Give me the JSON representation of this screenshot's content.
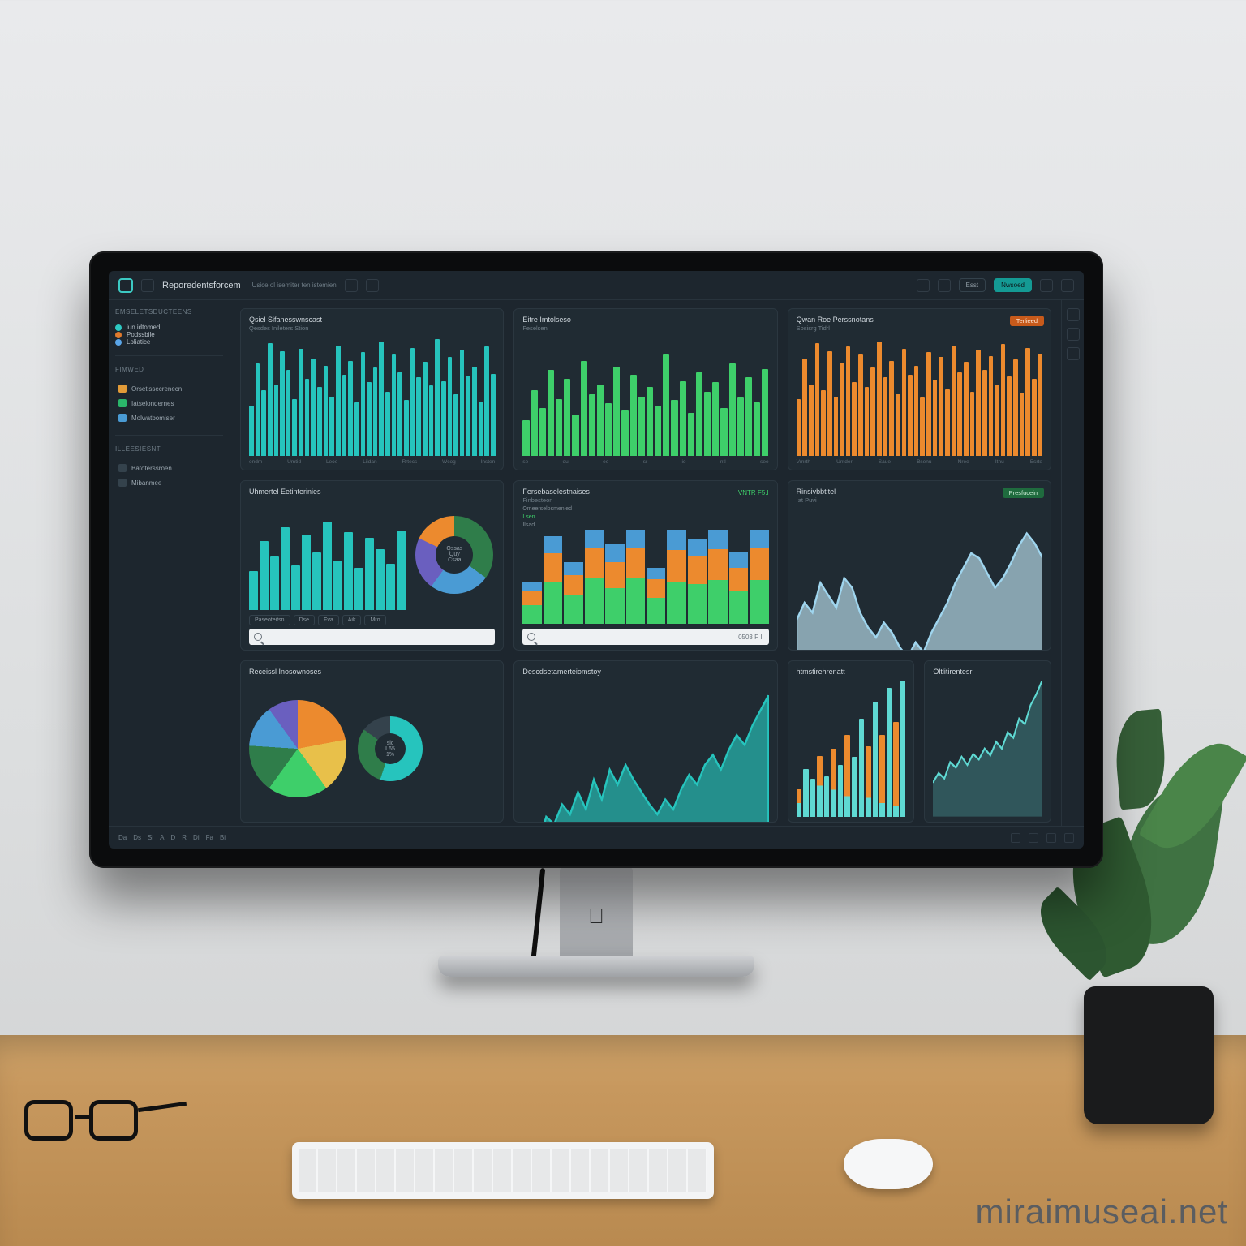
{
  "watermark": "miraimuseai.net",
  "header": {
    "title": "Reporedentsforcem",
    "subtitle": "Usice ol isemiter ten istemien",
    "action_primary": "Nwsoed",
    "action_secondary": "Esst"
  },
  "sidebar": {
    "section1_title": "Emseletsducteens",
    "legend": [
      {
        "label": "iun idtomed",
        "color": "#2dc9c3"
      },
      {
        "label": "Podssbile",
        "color": "#e07a2d"
      },
      {
        "label": "Loliatice",
        "color": "#5aa5e8"
      }
    ],
    "section2_title": "Fimwed",
    "items": [
      {
        "label": "Orsetissecrenecn",
        "color": "#e29b38"
      },
      {
        "label": "Iatselondernes",
        "color": "#2ab56a"
      },
      {
        "label": "Molwatbomiser",
        "color": "#4a9bd4"
      }
    ],
    "section3_title": "Illeesiesnt",
    "nav": [
      {
        "label": "Batoterssroen"
      },
      {
        "label": "Mibanmee"
      }
    ]
  },
  "cards": {
    "r1c1": {
      "title": "Qsiel Sifanesswnscast",
      "subtitle": "Qesdes Inileters Stion"
    },
    "r1c2": {
      "title": "Eitre Imtolseso",
      "subtitle": "Feselsen"
    },
    "r1c3": {
      "title": "Qwan Roe Perssnotans",
      "subtitle": "Sosisrg Tidrl",
      "badge": "Terlieed"
    },
    "r2c1": {
      "title": "Uhmertel Eetinterinies",
      "donut_center_top": "Qssas",
      "donut_center_mid": "Quy",
      "donut_center_bot": "Csaa",
      "search_placeholder": "",
      "toolbar": [
        "Paseoteitsn",
        "Dse",
        "Fva",
        "Aik",
        "Mro"
      ]
    },
    "r2c2": {
      "title": "Fersebaselestnaises",
      "subtitle": "Finbesteon",
      "stat": "VNTR F5.I",
      "search_value": "",
      "search_right": "0503 F II"
    },
    "r2c3": {
      "title": "Rinsivbbtitel",
      "subtitle": "Iat Puvi",
      "badge": "Presfucein"
    },
    "r3c1": {
      "title": "Receissl Inosownoses",
      "subtitle": "",
      "donut2_top": "sic",
      "donut2_mid": "L65",
      "donut2_bot": "1%"
    },
    "r3c2": {
      "title": "Descdsetamerteiomstoy"
    },
    "r3c3a": {
      "title": "htmstirehrenatt"
    },
    "r3c3b": {
      "title": "Oltlitirentesr"
    }
  },
  "footer": {
    "items": [
      "Da",
      "Ds",
      "Si",
      "A",
      "D",
      "R",
      "Di",
      "Fa",
      "Bi"
    ]
  },
  "colors": {
    "teal": "#26c4bd",
    "cyan": "#5fd9d3",
    "green": "#3ecf6a",
    "orange": "#ec8a2e",
    "orange2": "#d96b18",
    "blue": "#4a9bd4",
    "lightblue": "#9fd5ee",
    "purple": "#6a5fbf",
    "yellow": "#e8c04a",
    "darkgreen": "#2f7d4a"
  },
  "chart_data": [
    {
      "id": "r1c1",
      "type": "bar",
      "title": "Qsiel Sifanesswnscast",
      "categories": [
        "ondm",
        "Umtid",
        "Leoe",
        "Liidan",
        "Rrtecs",
        "Wcog",
        "Insten"
      ],
      "values": [
        42,
        78,
        55,
        95,
        60,
        88,
        72,
        48,
        90,
        65,
        82,
        58,
        76,
        50,
        93,
        68,
        80,
        45,
        87,
        62,
        74,
        96,
        54,
        85,
        70,
        47,
        91,
        66,
        79,
        59,
        98,
        63,
        83,
        52,
        89,
        67,
        75,
        46,
        92,
        69
      ],
      "color": "#26c4bd",
      "ylim": [
        0,
        100
      ]
    },
    {
      "id": "r1c2",
      "type": "bar",
      "title": "Eitre Imtolseso",
      "categories": [
        "se",
        "ou",
        "ee",
        "sr",
        "io",
        "ntl",
        "see"
      ],
      "values": [
        30,
        55,
        40,
        72,
        48,
        65,
        35,
        80,
        52,
        60,
        44,
        75,
        38,
        68,
        50,
        58,
        42,
        85,
        47,
        63,
        36,
        70,
        54,
        62,
        40,
        78,
        49,
        66,
        45,
        73
      ],
      "color": "#3ecf6a",
      "ylim": [
        0,
        100
      ]
    },
    {
      "id": "r1c3",
      "type": "bar",
      "title": "Qwan Roe Perssnotans",
      "categories": [
        "Vmrth",
        "Untder",
        "Saue",
        "Bsenu",
        "Nree",
        "Itnu",
        "Esrte"
      ],
      "values": [
        48,
        82,
        60,
        95,
        55,
        88,
        50,
        78,
        92,
        62,
        85,
        58,
        74,
        96,
        66,
        80,
        52,
        90,
        68,
        76,
        49,
        87,
        64,
        83,
        56,
        93,
        70,
        79,
        54,
        89,
        72,
        84,
        59,
        94,
        67,
        81,
        53,
        91,
        65,
        86
      ],
      "color": "#ec8a2e",
      "ylim": [
        0,
        100
      ]
    },
    {
      "id": "r2c1-bars",
      "type": "bar",
      "title": "Uhmertel Eetinterinies",
      "categories": [],
      "values": [
        35,
        62,
        48,
        75,
        40,
        68,
        52,
        80,
        45,
        70,
        38,
        65,
        55,
        42,
        72
      ],
      "color": "#26c4bd",
      "ylim": [
        0,
        100
      ]
    },
    {
      "id": "r2c1-donut",
      "type": "pie",
      "title": "",
      "series": [
        {
          "name": "a",
          "value": 35,
          "color": "#2f7d4a"
        },
        {
          "name": "b",
          "value": 25,
          "color": "#4a9bd4"
        },
        {
          "name": "c",
          "value": 22,
          "color": "#6a5fbf"
        },
        {
          "name": "d",
          "value": 18,
          "color": "#ec8a2e"
        }
      ]
    },
    {
      "id": "r2c2",
      "type": "bar",
      "title": "Fersebaselestnaises",
      "series": [
        {
          "name": "green",
          "color": "#3ecf6a",
          "values": [
            20,
            45,
            30,
            60,
            38,
            55,
            28,
            50,
            42,
            65,
            35,
            48
          ]
        },
        {
          "name": "orange",
          "color": "#ec8a2e",
          "values": [
            15,
            30,
            22,
            40,
            28,
            35,
            20,
            38,
            30,
            45,
            25,
            34
          ]
        },
        {
          "name": "blue",
          "color": "#4a9bd4",
          "values": [
            10,
            18,
            14,
            25,
            20,
            22,
            12,
            24,
            18,
            28,
            16,
            20
          ]
        }
      ],
      "categories": [
        "",
        "",
        "",
        "",
        "",
        "",
        "",
        "",
        "",
        "",
        "",
        ""
      ],
      "ylim": [
        0,
        100
      ]
    },
    {
      "id": "r2c3",
      "type": "area",
      "title": "Rinsivbbtitel",
      "values": [
        55,
        62,
        58,
        70,
        65,
        60,
        72,
        68,
        58,
        52,
        48,
        54,
        50,
        44,
        40,
        46,
        42,
        50,
        56,
        62,
        70,
        76,
        82,
        80,
        74,
        68,
        72,
        78,
        85,
        90,
        86,
        80
      ],
      "color": "#9fd5ee",
      "ylim": [
        0,
        100
      ]
    },
    {
      "id": "r3c1-pie",
      "type": "pie",
      "title": "Receissl Inosownoses",
      "series": [
        {
          "name": "a",
          "value": 22,
          "color": "#ec8a2e"
        },
        {
          "name": "b",
          "value": 18,
          "color": "#e8c04a"
        },
        {
          "name": "c",
          "value": 20,
          "color": "#3ecf6a"
        },
        {
          "name": "d",
          "value": 16,
          "color": "#2f7d4a"
        },
        {
          "name": "e",
          "value": 14,
          "color": "#4a9bd4"
        },
        {
          "name": "f",
          "value": 10,
          "color": "#6a5fbf"
        }
      ]
    },
    {
      "id": "r3c1-donut",
      "type": "pie",
      "title": "",
      "series": [
        {
          "name": "a",
          "value": 55,
          "color": "#26c4bd"
        },
        {
          "name": "b",
          "value": 30,
          "color": "#2f7d4a"
        },
        {
          "name": "c",
          "value": 15,
          "color": "#34424c"
        }
      ]
    },
    {
      "id": "r3c2",
      "type": "area",
      "title": "Descdsetamerteiomstoy",
      "values": [
        30,
        38,
        34,
        45,
        42,
        50,
        46,
        55,
        48,
        60,
        52,
        64,
        58,
        66,
        60,
        55,
        50,
        46,
        52,
        48,
        56,
        62,
        58,
        66,
        70,
        64,
        72,
        78,
        74,
        82,
        88,
        94
      ],
      "color": "#26c4bd",
      "ylim": [
        0,
        100
      ]
    },
    {
      "id": "r3c3a",
      "type": "bar",
      "title": "htmstirehrenatt",
      "values": [
        20,
        35,
        28,
        45,
        30,
        50,
        38,
        60,
        44,
        72,
        52,
        85,
        60,
        95,
        70,
        100
      ],
      "color": "#5fd9d3",
      "ylim": [
        0,
        100
      ],
      "overlay": {
        "color": "#ec8a2e",
        "values": [
          10,
          0,
          0,
          22,
          0,
          30,
          0,
          45,
          0,
          0,
          38,
          0,
          50,
          0,
          62,
          0
        ]
      }
    },
    {
      "id": "r3c3b",
      "type": "line",
      "title": "Oltlitirentesr",
      "values": [
        25,
        32,
        28,
        40,
        36,
        44,
        38,
        46,
        42,
        50,
        45,
        55,
        50,
        62,
        58,
        72,
        68,
        82,
        90,
        100
      ],
      "color": "#5fd9d3",
      "ylim": [
        0,
        100
      ]
    }
  ]
}
